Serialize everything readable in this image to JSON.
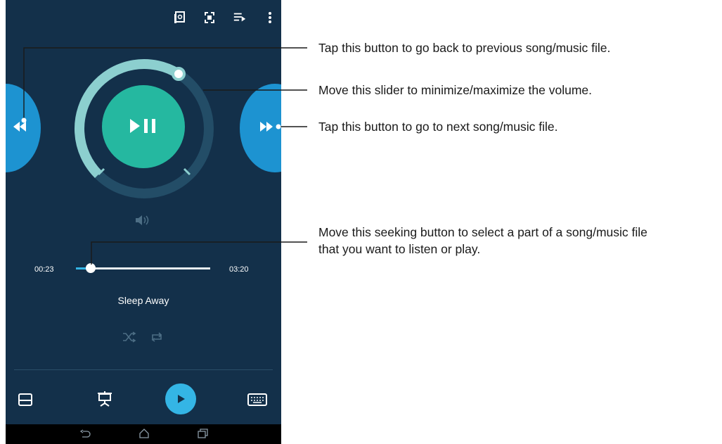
{
  "player": {
    "current_time": "00:23",
    "total_time": "03:20",
    "song_title": "Sleep Away",
    "seek_progress": 0.11,
    "volume_level": 0.62
  },
  "top_bar": {
    "icons": [
      "cast-icon",
      "fullscreen-icon",
      "playlist-icon",
      "overflow-menu-icon"
    ]
  },
  "bottom_bar": {
    "icons": [
      "floating-window-icon",
      "presentation-icon",
      "play-icon",
      "keyboard-icon"
    ]
  },
  "annotations": {
    "previous": "Tap this button to go back to previous song/music file.",
    "volume": "Move this slider to minimize/maximize the volume.",
    "next": "Tap this button to go to next song/music file.",
    "seek_line1": "Move this seeking button to select a part of a song/music file",
    "seek_line2": "that you want to listen or play."
  },
  "colors": {
    "background": "#13304a",
    "accent_teal": "#25b8a0",
    "ring_light": "#8ccfcf",
    "ring_dark": "#234d67",
    "side_button": "#1d93d1",
    "play_button": "#34b5e5",
    "navbar": "#000000"
  }
}
